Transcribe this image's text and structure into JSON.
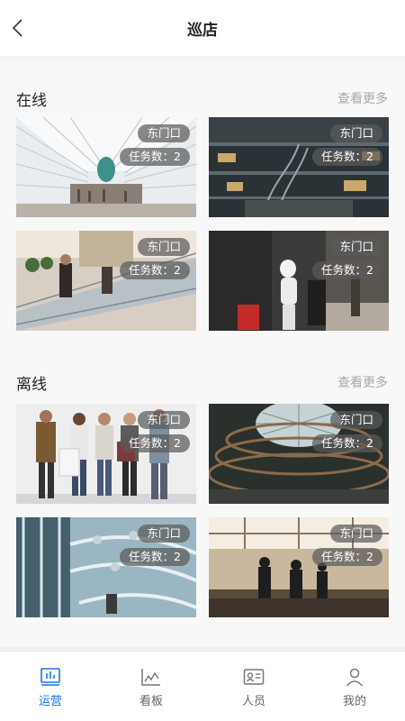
{
  "header": {
    "title": "巡店"
  },
  "online": {
    "title": "在线",
    "more": "查看更多",
    "cards": [
      {
        "name": "东门口",
        "tasks": "任务数：2"
      },
      {
        "name": "东门口",
        "tasks": "任务数：2"
      },
      {
        "name": "东门口",
        "tasks": "任务数：2"
      },
      {
        "name": "东门口",
        "tasks": "任务数：2"
      }
    ]
  },
  "offline": {
    "title": "离线",
    "more": "查看更多",
    "cards": [
      {
        "name": "东门口",
        "tasks": "任务数：2"
      },
      {
        "name": "东门口",
        "tasks": "任务数：2"
      },
      {
        "name": "东门口",
        "tasks": "任务数：2"
      },
      {
        "name": "东门口",
        "tasks": "任务数：2"
      }
    ]
  },
  "tabbar": {
    "active_color": "#1a73e8",
    "items": [
      {
        "label": "运营",
        "icon": "monitor-icon",
        "active": true
      },
      {
        "label": "看板",
        "icon": "chart-icon",
        "active": false
      },
      {
        "label": "人员",
        "icon": "id-card-icon",
        "active": false
      },
      {
        "label": "我的",
        "icon": "person-icon",
        "active": false
      }
    ]
  }
}
